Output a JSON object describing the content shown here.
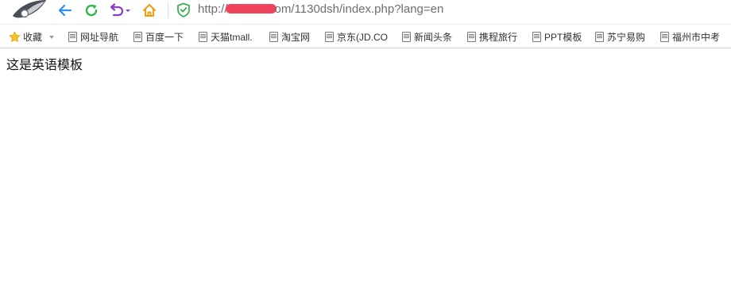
{
  "address_bar": {
    "url_prefix": "http://",
    "url_suffix": "om/1130dsh/index.php?lang=en"
  },
  "bookmarks": {
    "favorites_label": "收藏",
    "items": [
      "网址导航",
      "百度一下",
      "天猫tmall.",
      "淘宝网",
      "京东(JD.CO",
      "新闻头条",
      "携程旅行",
      "PPT模板",
      "苏宁易购",
      "福州市中考"
    ]
  },
  "page": {
    "text": "这是英语模板"
  },
  "colors": {
    "back": "#2f8ef0",
    "refresh": "#2fb84b",
    "undo": "#8a3cc8",
    "home": "#f39c12",
    "shield": "#37b24d",
    "redaction": "#f0445c"
  },
  "icons": [
    "browser-logo-icon",
    "back-arrow-icon",
    "refresh-icon",
    "undo-icon",
    "home-icon",
    "security-shield-icon",
    "star-icon",
    "page-icon"
  ]
}
